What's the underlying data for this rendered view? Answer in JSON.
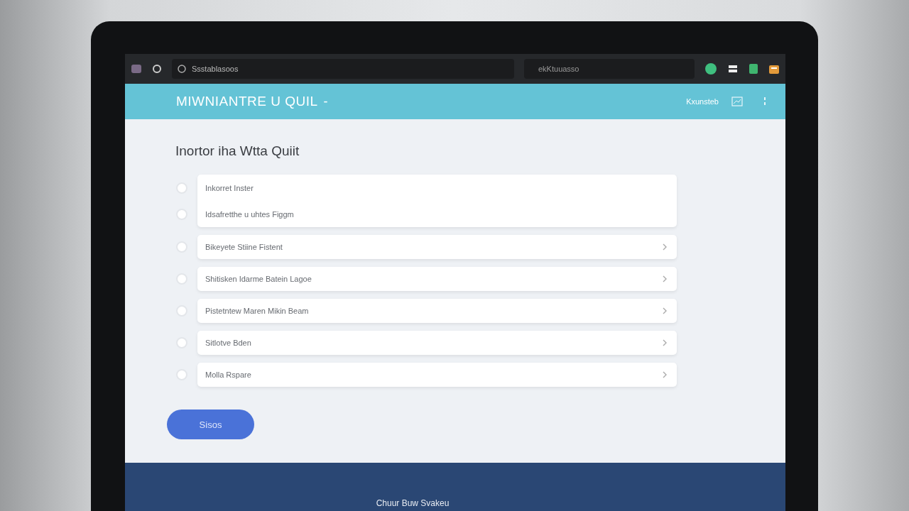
{
  "browser": {
    "address": "Ssstablasoos",
    "search": "ekKtuuasso"
  },
  "app_header": {
    "title": "MIWNIANTRE U QUIL",
    "title_suffix": "-",
    "right_label": "Kxunsteb"
  },
  "quiz": {
    "title": "Inortor iha Wtta Quiit",
    "cards": [
      {
        "chevron": false,
        "options": [
          {
            "label": "Inkorret Inster",
            "selected": false
          },
          {
            "label": "Idsafretthe u uhtes Figgm",
            "selected": false
          }
        ]
      },
      {
        "chevron": true,
        "options": [
          {
            "label": "Bikeyete Stiine Fistent",
            "selected": false
          }
        ]
      },
      {
        "chevron": true,
        "options": [
          {
            "label": "Shitisken Idarme Batein Lagoe",
            "selected": false
          }
        ]
      },
      {
        "chevron": true,
        "options": [
          {
            "label": "Pistetntew Maren Mikin Beam",
            "selected": false
          }
        ]
      },
      {
        "chevron": true,
        "options": [
          {
            "label": "Sitlotve Bden",
            "selected": false
          }
        ]
      },
      {
        "chevron": true,
        "options": [
          {
            "label": "Molla Rspare",
            "selected": false
          }
        ]
      }
    ]
  },
  "submit_button": "Sisos",
  "footer": {
    "text": "Chuur Buw Svakeu"
  }
}
